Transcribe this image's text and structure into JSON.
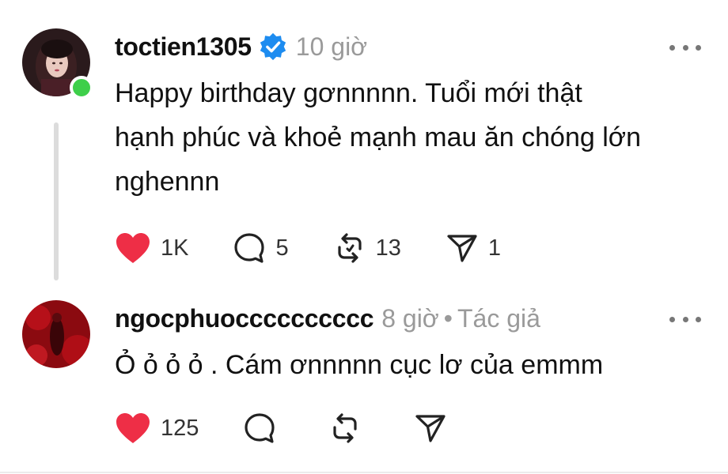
{
  "post1": {
    "username": "toctien1305",
    "time": "10 giờ",
    "text_line1": "Happy birthday gơnnnnn. Tuổi mới thật",
    "text_line2": "hạnh phúc và khoẻ mạnh mau ăn chóng lớn",
    "text_line3": "nghennn",
    "likes": "1K",
    "replies": "5",
    "reposts": "13",
    "shares": "1",
    "verified": true,
    "online": true,
    "liked": true
  },
  "post2": {
    "username": "ngocphuocccccccccc",
    "time": "8 giờ",
    "separator": "•",
    "author_tag": "Tác giả",
    "text": "Ỏ ỏ ỏ ỏ . Cám ơnnnnn cục lơ của emmm",
    "likes": "125",
    "liked": true
  },
  "colors": {
    "like_red": "#ee2e46",
    "verified_blue": "#1d8cf0",
    "online_green": "#3ecf4a",
    "meta_gray": "#9a9a9a"
  },
  "icons": [
    "heart-icon",
    "comment-icon",
    "repost-icon",
    "share-icon",
    "more-icon",
    "verified-badge-icon"
  ]
}
